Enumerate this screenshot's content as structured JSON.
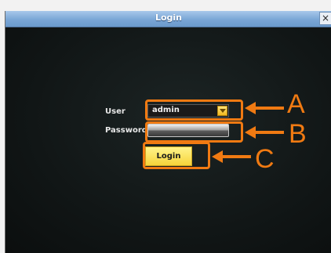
{
  "window": {
    "title": "Login",
    "close_glyph": "×"
  },
  "form": {
    "user_label": "User",
    "user_value": "admin",
    "password_label": "Password",
    "password_value": "",
    "login_label": "Login"
  },
  "callouts": {
    "a": "A",
    "b": "B",
    "c": "C"
  },
  "colors": {
    "accent": "#f07a12",
    "button": "#f7d43a",
    "titlebar": "#7aa6d6"
  },
  "icons": {
    "close": "close-icon",
    "dropdown": "chevron-down-icon",
    "arrow": "left-arrow-icon"
  }
}
